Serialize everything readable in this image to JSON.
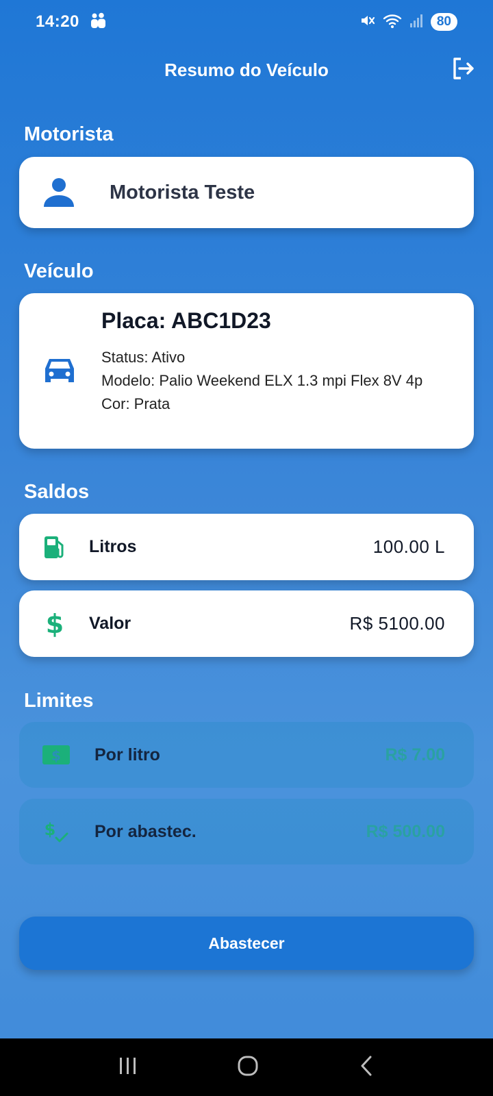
{
  "status_bar": {
    "time": "14:20",
    "battery": "80"
  },
  "app_bar": {
    "title": "Resumo do Veículo"
  },
  "driver": {
    "section_title": "Motorista",
    "name": "Motorista Teste"
  },
  "vehicle": {
    "section_title": "Veículo",
    "plate": "Placa: ABC1D23",
    "status": "Status: Ativo",
    "model": "Modelo: Palio Weekend ELX 1.3 mpi Flex 8V 4p",
    "color": "Cor: Prata"
  },
  "balances": {
    "section_title": "Saldos",
    "liters": {
      "label": "Litros",
      "value": "100.00 L"
    },
    "amount": {
      "label": "Valor",
      "value": "R$ 5100.00"
    }
  },
  "limits": {
    "section_title": "Limites",
    "per_liter": {
      "label": "Por litro",
      "value": "R$ 7.00"
    },
    "per_refuel": {
      "label": "Por abastec.",
      "value": "R$ 500.00"
    }
  },
  "action": {
    "label": "Abastecer"
  },
  "colors": {
    "primary": "#1c75d4",
    "accent_green": "#1bb07a",
    "icon_blue": "#1f6fd0"
  }
}
